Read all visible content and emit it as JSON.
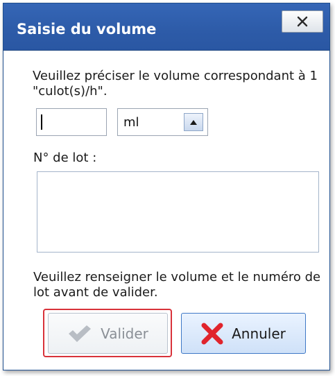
{
  "dialog": {
    "title": "Saisie du volume",
    "close_glyph": "✕",
    "prompt": "Veuillez préciser le volume correspondant à 1 \"culot(s)/h\".",
    "volume": {
      "value": "",
      "unit": "ml",
      "dropdown_icon": "triangle-up-icon"
    },
    "lot": {
      "label": "N° de lot :",
      "value": ""
    },
    "warning": "Veuillez renseigner le volume et le numéro de lot avant de valider.",
    "buttons": {
      "validate": {
        "label": "Valider",
        "icon": "checkmark-icon",
        "enabled": false
      },
      "cancel": {
        "label": "Annuler",
        "icon": "red-x-icon",
        "enabled": true
      }
    }
  },
  "colors": {
    "titlebar": "#2d5ba8",
    "focus_ring": "#d8323a",
    "cancel_icon": "#e0242c",
    "disabled_text": "#8a8f96"
  }
}
